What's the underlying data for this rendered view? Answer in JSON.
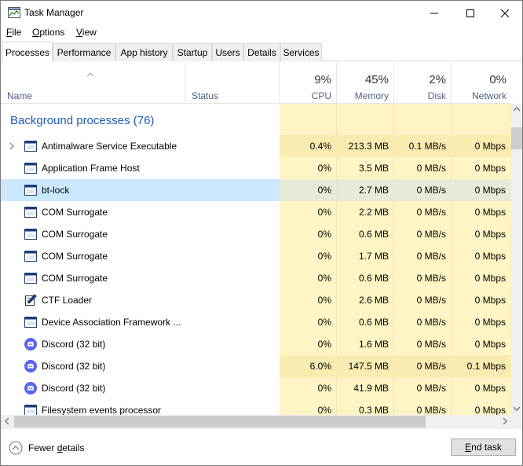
{
  "window": {
    "title": "Task Manager",
    "icon": "task-manager-icon",
    "controls": [
      "minimize-icon",
      "maximize-icon",
      "close-icon"
    ]
  },
  "menu": [
    {
      "label": "File",
      "mnemonic": "F",
      "rest": "ile"
    },
    {
      "label": "Options",
      "mnemonic": "O",
      "rest": "ptions"
    },
    {
      "label": "View",
      "mnemonic": "V",
      "rest": "iew"
    }
  ],
  "tabs": [
    "Processes",
    "Performance",
    "App history",
    "Startup",
    "Users",
    "Details",
    "Services"
  ],
  "active_tab": "Processes",
  "columns": {
    "name": "Name",
    "status": "Status",
    "cpu": {
      "percent": "9%",
      "label": "CPU"
    },
    "memory": {
      "percent": "45%",
      "label": "Memory"
    },
    "disk": {
      "percent": "2%",
      "label": "Disk"
    },
    "network": {
      "percent": "0%",
      "label": "Network"
    }
  },
  "group": {
    "title": "Background processes (76)"
  },
  "processes": [
    {
      "name": "Antimalware Service Executable",
      "icon": "window-icon",
      "expandable": true,
      "cpu": "0.4%",
      "memory": "213.3 MB",
      "disk": "0.1 MB/s",
      "network": "0 Mbps",
      "highlight": true
    },
    {
      "name": "Application Frame Host",
      "icon": "window-icon",
      "cpu": "0%",
      "memory": "3.5 MB",
      "disk": "0 MB/s",
      "network": "0 Mbps"
    },
    {
      "name": "bt-lock",
      "icon": "window-icon",
      "cpu": "0%",
      "memory": "2.7 MB",
      "disk": "0 MB/s",
      "network": "0 Mbps",
      "selected": true
    },
    {
      "name": "COM Surrogate",
      "icon": "window-icon",
      "cpu": "0%",
      "memory": "2.2 MB",
      "disk": "0 MB/s",
      "network": "0 Mbps"
    },
    {
      "name": "COM Surrogate",
      "icon": "window-icon",
      "cpu": "0%",
      "memory": "0.6 MB",
      "disk": "0 MB/s",
      "network": "0 Mbps"
    },
    {
      "name": "COM Surrogate",
      "icon": "window-icon",
      "cpu": "0%",
      "memory": "1.7 MB",
      "disk": "0 MB/s",
      "network": "0 Mbps"
    },
    {
      "name": "COM Surrogate",
      "icon": "window-icon",
      "cpu": "0%",
      "memory": "0.6 MB",
      "disk": "0 MB/s",
      "network": "0 Mbps"
    },
    {
      "name": "CTF Loader",
      "icon": "pen-icon",
      "cpu": "0%",
      "memory": "2.6 MB",
      "disk": "0 MB/s",
      "network": "0 Mbps"
    },
    {
      "name": "Device Association Framework ...",
      "icon": "window-icon",
      "cpu": "0%",
      "memory": "0.6 MB",
      "disk": "0 MB/s",
      "network": "0 Mbps"
    },
    {
      "name": "Discord (32 bit)",
      "icon": "discord-icon",
      "cpu": "0%",
      "memory": "1.6 MB",
      "disk": "0 MB/s",
      "network": "0 Mbps"
    },
    {
      "name": "Discord (32 bit)",
      "icon": "discord-icon",
      "cpu": "6.0%",
      "memory": "147.5 MB",
      "disk": "0 MB/s",
      "network": "0.1 Mbps",
      "highlight": true
    },
    {
      "name": "Discord (32 bit)",
      "icon": "discord-icon",
      "cpu": "0%",
      "memory": "41.9 MB",
      "disk": "0 MB/s",
      "network": "0 Mbps"
    },
    {
      "name": "Filesystem events processor",
      "icon": "window-icon",
      "cpu": "0%",
      "memory": "0.3 MB",
      "disk": "0 MB/s",
      "network": "0 Mbps"
    }
  ],
  "footer": {
    "fewer_details": "Fewer details",
    "fewer_mnemonic": "d",
    "end_task": "End task",
    "end_mnemonic": "E"
  },
  "colors": {
    "heat": "#fff4c4",
    "heat_strong": "#f9ecb0",
    "selected": "#cce8ff",
    "group": "#1e5bb8",
    "header_label": "#4d6082"
  }
}
